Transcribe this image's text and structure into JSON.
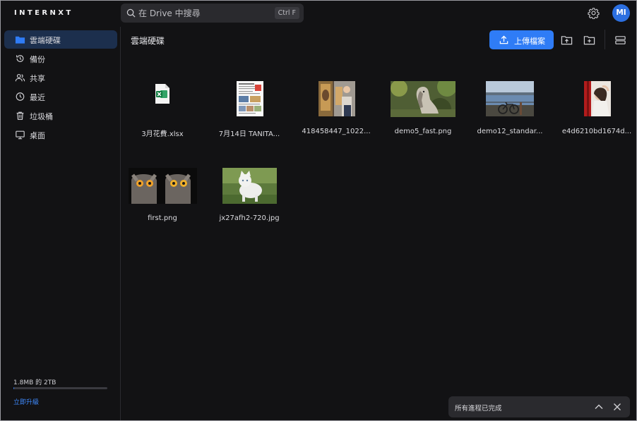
{
  "app": {
    "logo": "INTERNXT"
  },
  "search": {
    "placeholder": "在 Drive 中搜尋",
    "shortcut": "Ctrl F"
  },
  "header": {
    "avatar_initials": "MI"
  },
  "sidebar": {
    "items": [
      {
        "label": "雲端硬碟",
        "icon": "folder-icon"
      },
      {
        "label": "備份",
        "icon": "history-icon"
      },
      {
        "label": "共享",
        "icon": "users-icon"
      },
      {
        "label": "最近",
        "icon": "clock-icon"
      },
      {
        "label": "垃圾桶",
        "icon": "trash-icon"
      },
      {
        "label": "桌面",
        "icon": "desktop-icon"
      }
    ],
    "storage": {
      "used_text": "1.8MB 的 2TB",
      "used_fraction": 0.01
    },
    "upgrade_label": "立即升級"
  },
  "main": {
    "breadcrumb": "雲端硬碟",
    "upload_label": "上傳檔案",
    "files": [
      {
        "name": "3月花費.xlsx",
        "kind": "xlsx"
      },
      {
        "name": "7月14日 TANITA...",
        "kind": "doc"
      },
      {
        "name": "418458447_1022...",
        "kind": "image"
      },
      {
        "name": "demo5_fast.png",
        "kind": "image"
      },
      {
        "name": "demo12_standar...",
        "kind": "image"
      },
      {
        "name": "e4d6210bd1674d...",
        "kind": "image"
      },
      {
        "name": "first.png",
        "kind": "image"
      },
      {
        "name": "jx27afh2-720.jpg",
        "kind": "image"
      }
    ]
  },
  "toast": {
    "text": "所有進程已完成"
  },
  "colors": {
    "accent": "#2f7cf6",
    "background": "#121214",
    "active_nav": "#1c2f4d"
  }
}
